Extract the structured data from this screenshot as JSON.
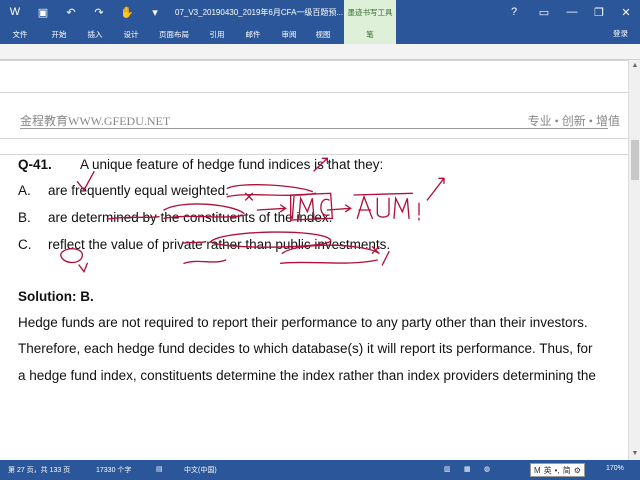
{
  "titlebar": {
    "doc_title": "07_V3_20190430_2019年6月CFA一级百题预...",
    "context_tab": "墨迹书写工具"
  },
  "ribbon": {
    "tabs": [
      "文件",
      "开始",
      "插入",
      "设计",
      "页面布局",
      "引用",
      "邮件",
      "审阅",
      "视图",
      "笔"
    ],
    "login": "登录"
  },
  "page_header": {
    "left": "金程教育WWW.GFEDU.NET",
    "right": "专业 • 创新 • 增值"
  },
  "question": {
    "label": "Q-41.",
    "text": "A unique feature of hedge fund indices is that they:",
    "options": [
      {
        "label": "A.",
        "text": "are frequently equal weighted."
      },
      {
        "label": "B.",
        "text": "are determined by the constituents of the index."
      },
      {
        "label": "C.",
        "text": "reflect the value of private rather than public investments."
      }
    ]
  },
  "solution": {
    "title": "Solution: B.",
    "lines": [
      "Hedge funds are not required to report their performance to any party other than their investors.",
      "Therefore, each hedge fund decides to which database(s) it will report its performance. Thus, for",
      "a hedge fund index, constituents determine the index rather than index providers determining the"
    ]
  },
  "annotation_text": "IMC → AUM",
  "statusbar": {
    "page": "第 27 页，共 133 页",
    "words": "17330 个字",
    "language": "中文(中国)",
    "ime": "英",
    "ime2": "简",
    "zoom": "170%"
  },
  "colors": {
    "word_blue": "#2b579a",
    "ink_red": "#b0103a",
    "pen_tab_green": "#dff0d8"
  }
}
